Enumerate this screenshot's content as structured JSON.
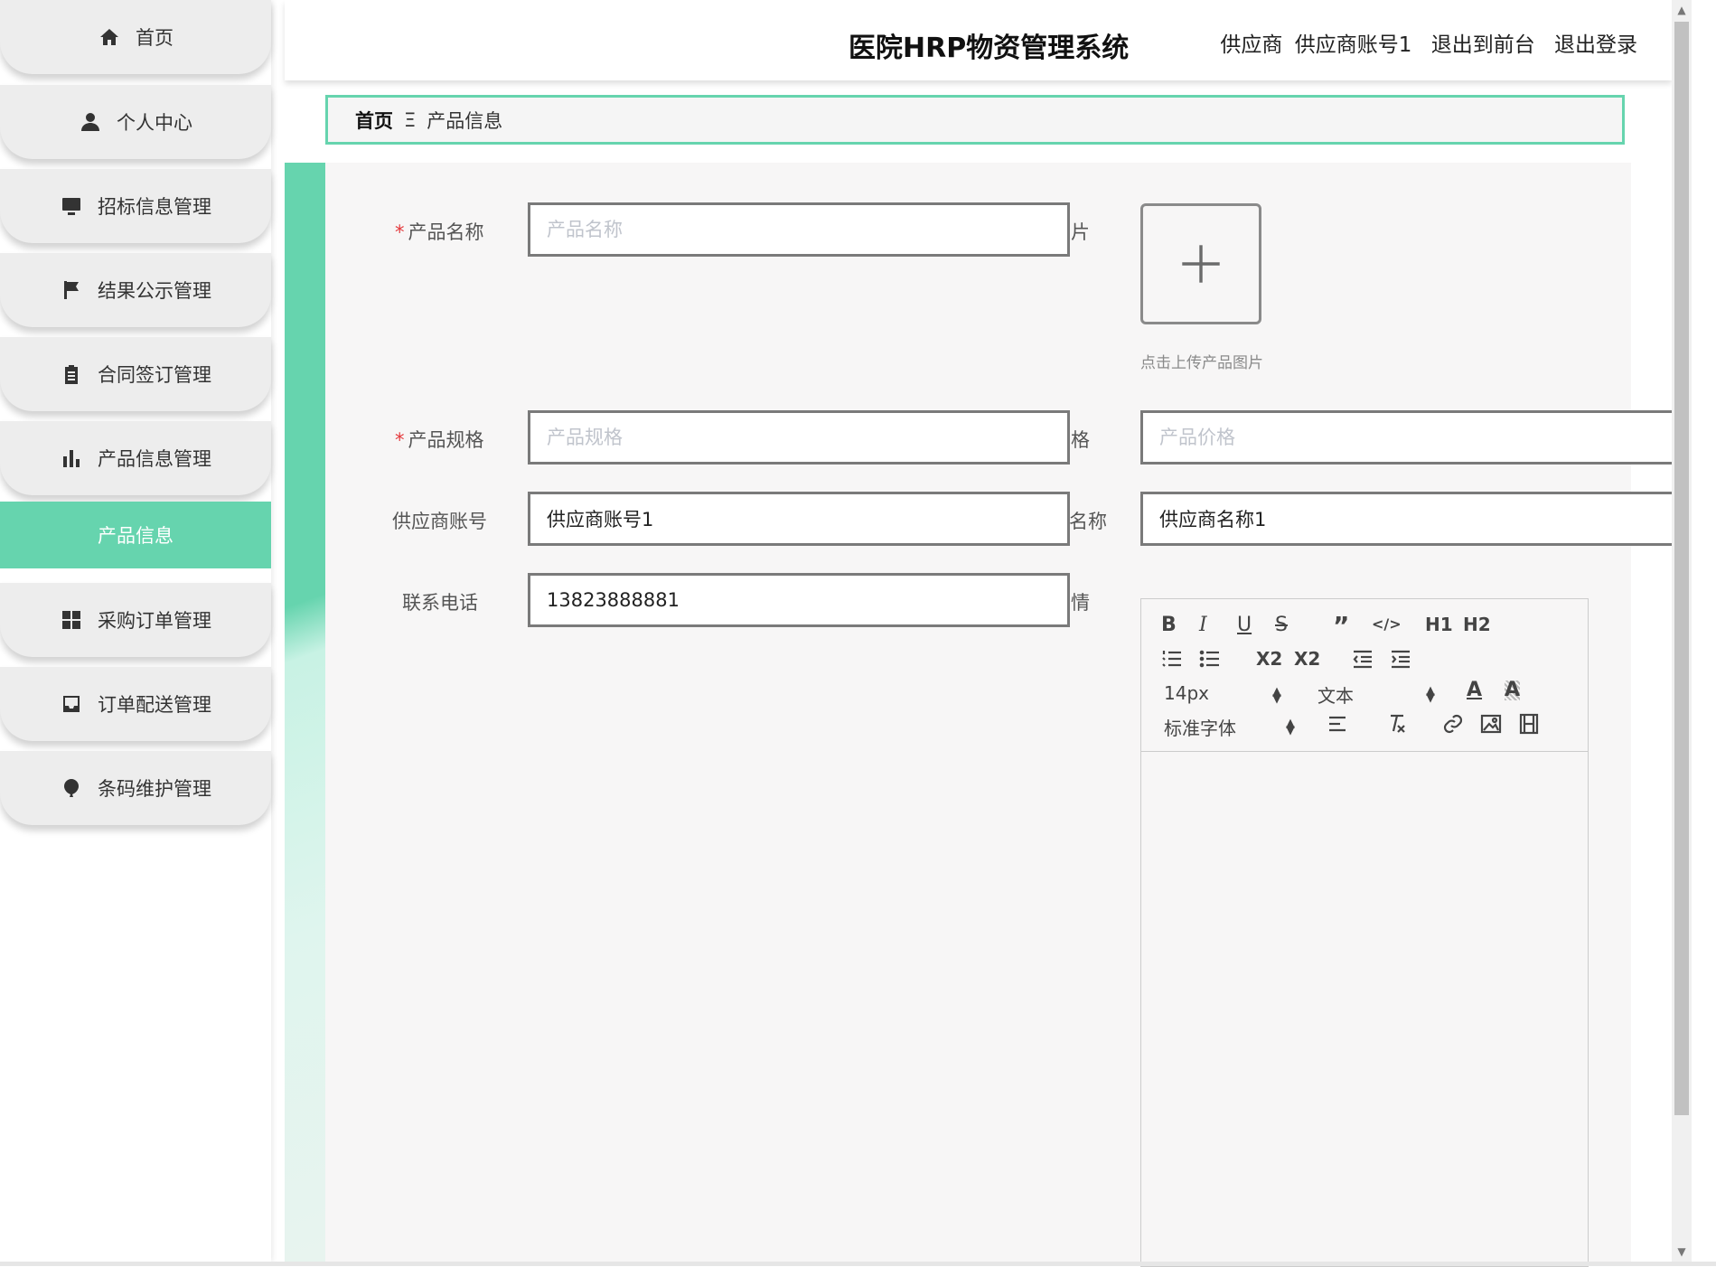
{
  "app_title": "医院HRP物资管理系统",
  "header": {
    "role": "供应商",
    "username": "供应商账号1",
    "to_front": "退出到前台",
    "logout": "退出登录"
  },
  "sidebar": {
    "items": [
      {
        "label": "首页",
        "icon": "home-icon"
      },
      {
        "label": "个人中心",
        "icon": "person-icon"
      },
      {
        "label": "招标信息管理",
        "icon": "monitor-icon"
      },
      {
        "label": "结果公示管理",
        "icon": "flag-icon"
      },
      {
        "label": "合同签订管理",
        "icon": "clipboard-icon"
      },
      {
        "label": "产品信息管理",
        "icon": "bar-chart-icon"
      },
      {
        "label": "采购订单管理",
        "icon": "grid-icon"
      },
      {
        "label": "订单配送管理",
        "icon": "inbox-icon"
      },
      {
        "label": "条码维护管理",
        "icon": "balloon-icon"
      }
    ],
    "active_sub": "产品信息"
  },
  "breadcrumb": {
    "home": "首页",
    "separator": "Ξ",
    "current": "产品信息"
  },
  "form": {
    "product_name": {
      "label": "产品名称",
      "placeholder": "产品名称",
      "value": ""
    },
    "product_image": {
      "clipped_label": "片",
      "hint": "点击上传产品图片"
    },
    "product_spec": {
      "label": "产品规格",
      "placeholder": "产品规格",
      "value": ""
    },
    "product_price": {
      "clipped_label": "格",
      "placeholder": "产品价格",
      "value": ""
    },
    "supplier_account": {
      "label": "供应商账号",
      "value": "供应商账号1"
    },
    "supplier_name": {
      "clipped_label": "名称",
      "value": "供应商名称1"
    },
    "phone": {
      "label": "联系电话",
      "value": "13823888881"
    },
    "details": {
      "clipped_label": "情"
    }
  },
  "editor": {
    "font_size": "14px",
    "heading": "文本",
    "font_family": "标准字体",
    "buttons": {
      "bold": "B",
      "italic": "I",
      "underline": "U",
      "strike": "S",
      "blockquote": "”",
      "code": "</>",
      "h1": "H1",
      "h2": "H2",
      "subscript": "X2",
      "superscript": "X2"
    }
  },
  "colors": {
    "accent": "#66d4ae",
    "required": "#e4393c"
  }
}
